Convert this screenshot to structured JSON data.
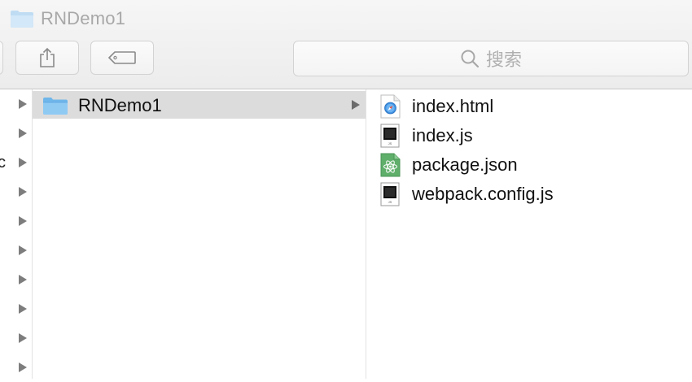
{
  "window": {
    "title": "RNDemo1"
  },
  "toolbar": {
    "search_placeholder": "搜索"
  },
  "column1": {
    "partial_label": "c",
    "rows": 10
  },
  "column2": {
    "items": [
      {
        "name": "RNDemo1",
        "type": "folder",
        "selected": true
      }
    ]
  },
  "column3": {
    "items": [
      {
        "name": "index.html",
        "icon": "html-file-icon"
      },
      {
        "name": "index.js",
        "icon": "js-file-icon"
      },
      {
        "name": "package.json",
        "icon": "json-file-icon"
      },
      {
        "name": "webpack.config.js",
        "icon": "js-file-icon"
      }
    ]
  },
  "colors": {
    "folder": "#8cc8f2",
    "selection": "#dcdcdc",
    "disabled_text": "#a8a8a8"
  }
}
